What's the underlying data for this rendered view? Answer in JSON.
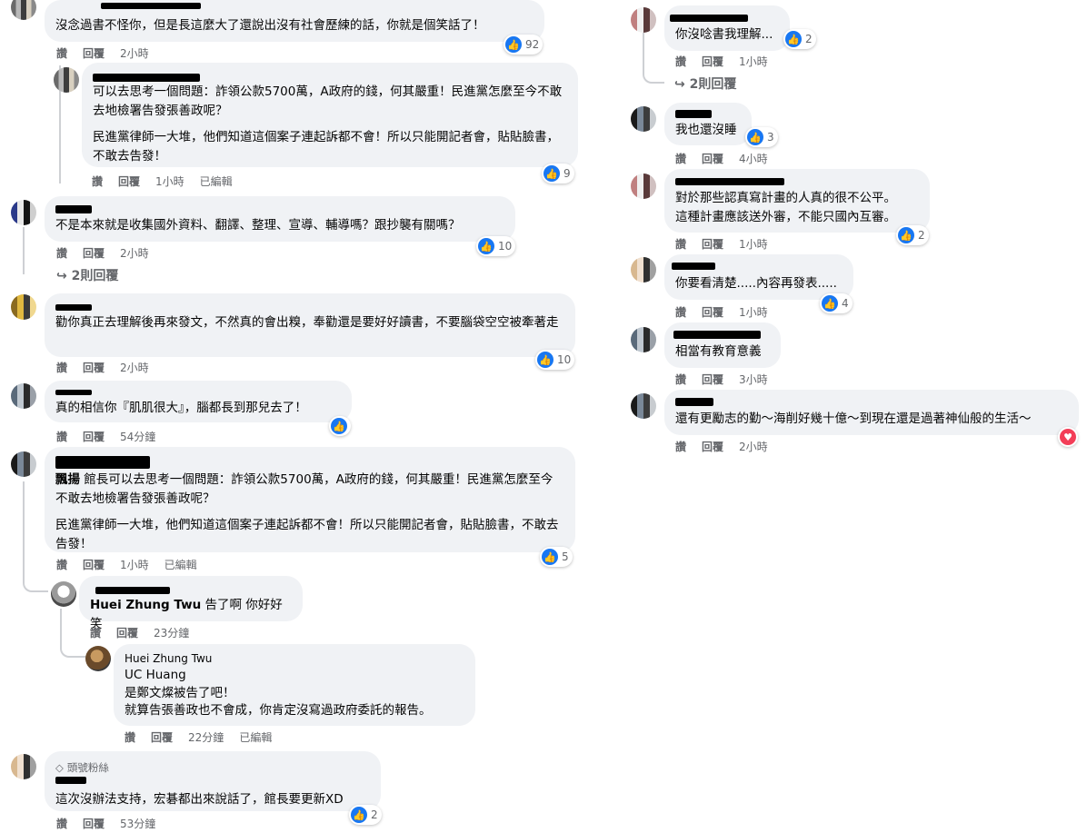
{
  "left": {
    "c1": {
      "text": "沒念過書不怪你，但是長這麼大了還說出沒有社會歷練的話，你就是個笑話了！",
      "like": "讚",
      "reply": "回覆",
      "time": "2小時",
      "reactions": "92"
    },
    "c2": {
      "p1": "可以去思考一個問題：詐領公款5700萬，A政府的錢，何其嚴重！民進黨怎麼至今不敢去地檢署告發張善政呢？",
      "p2": "民進黨律師一大堆，他們知道這個案子連起訴都不會！所以只能開記者會，貼貼臉書，不敢去告發！",
      "like": "讚",
      "reply": "回覆",
      "time": "1小時",
      "edited": "已編輯",
      "reactions": "9"
    },
    "c3": {
      "text": "不是本來就是收集國外資料、翻譯、整理、宣導、輔導嗎？跟抄襲有關嗎？",
      "like": "讚",
      "reply": "回覆",
      "time": "2小時",
      "reactions": "10",
      "replies": "2則回覆"
    },
    "c4": {
      "text": "勸你真正去理解後再來發文，不然真的會出糗，奉勸還是要好好讀書，不要腦袋空空被牽著走",
      "like": "讚",
      "reply": "回覆",
      "time": "2小時",
      "reactions": "10"
    },
    "c5": {
      "text": "真的相信你『肌肌很大』，腦都長到那兒去了！",
      "like": "讚",
      "reply": "回覆",
      "time": "54分鐘"
    },
    "c6": {
      "tag": "飄揚",
      "p1": "館長可以去思考一個問題：詐領公款5700萬，A政府的錢，何其嚴重！民進黨怎麼至今不敢去地檢署告發張善政呢？",
      "p2": "民進黨律師一大堆，他們知道這個案子連起訴都不會！所以只能開記者會，貼貼臉書，不敢去告發！",
      "like": "讚",
      "reply": "回覆",
      "time": "1小時",
      "edited": "已編輯",
      "reactions": "5"
    },
    "c7": {
      "mention": "Huei Zhung Twu",
      "text": "告了啊 你好好笑",
      "like": "讚",
      "reply": "回覆",
      "time": "23分鐘"
    },
    "c8": {
      "name": "Huei Zhung Twu",
      "mention": "UC Huang",
      "l1": "是鄭文燦被告了吧！",
      "l2": "就算告張善政也不會成，你肯定沒寫過政府委託的報告。",
      "like": "讚",
      "reply": "回覆",
      "time": "22分鐘",
      "edited": "已編輯"
    },
    "c9": {
      "badge": "頭號粉絲",
      "text": "這次沒辦法支持，宏碁都出來說話了，館長要更新XD",
      "like": "讚",
      "reply": "回覆",
      "time": "53分鐘",
      "reactions": "2"
    }
  },
  "right": {
    "r1": {
      "text": "你沒唸書我理解...",
      "like": "讚",
      "reply": "回覆",
      "time": "1小時",
      "reactions": "2",
      "replies": "2則回覆"
    },
    "r2": {
      "text": "我也還沒睡",
      "like": "讚",
      "reply": "回覆",
      "time": "4小時",
      "reactions": "3"
    },
    "r3": {
      "l1": "對於那些認真寫計畫的人真的很不公平。",
      "l2": "這種計畫應該送外審，不能只國內互審。",
      "like": "讚",
      "reply": "回覆",
      "time": "1小時",
      "reactions": "2"
    },
    "r4": {
      "text": "你要看清楚.....內容再發表.....",
      "like": "讚",
      "reply": "回覆",
      "time": "1小時",
      "reactions": "4"
    },
    "r5": {
      "text": "相當有教育意義",
      "like": "讚",
      "reply": "回覆",
      "time": "3小時"
    },
    "r6": {
      "text": "還有更勵志的勤～海削好幾十億～到現在還是過著神仙般的生活～",
      "like": "讚",
      "reply": "回覆",
      "time": "2小時"
    }
  },
  "icons": {
    "like": "thumbs-up-icon",
    "love": "heart-icon",
    "reply_arrow": "reply-arrow-icon",
    "badge": "diamond-icon"
  },
  "colors": {
    "bubble": "#f0f2f5",
    "like_blue": "#1877f2",
    "love_red": "#f33e58",
    "meta_gray": "#65676b"
  }
}
